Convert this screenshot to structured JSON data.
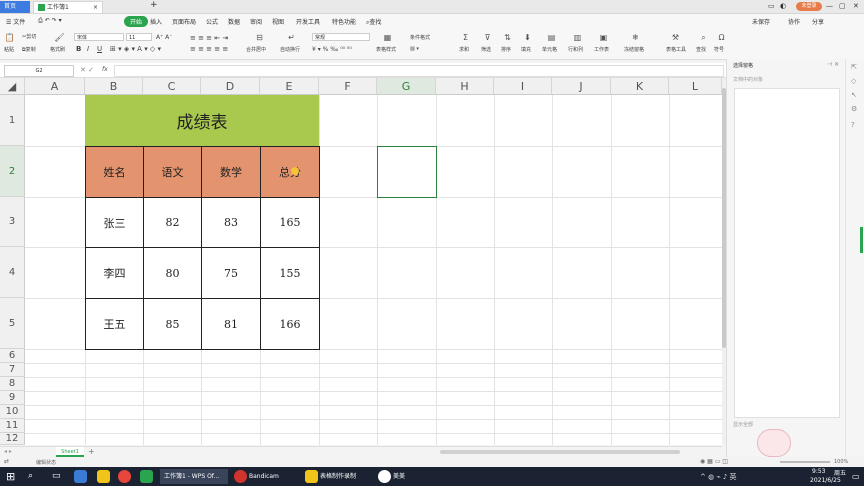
{
  "app": {
    "home_tab": "首页",
    "book_tab": "工作簿1",
    "tab_close": "×",
    "new_tab": "+",
    "login_button": "未登录"
  },
  "menu": {
    "file": "☰ 文件",
    "start": "开始",
    "items": [
      "插入",
      "页面布局",
      "公式",
      "数据",
      "审阅",
      "视图",
      "开发工具",
      "特色功能"
    ],
    "search": "查找",
    "right_items": [
      "未保存",
      "协作",
      "分享"
    ]
  },
  "toolbar": {
    "cut": "剪切",
    "paste": "粘贴",
    "copy": "复制",
    "format_painter": "格式刷",
    "font_name": "宋体",
    "font_size": "11",
    "bold": "B",
    "italic": "I",
    "underline": "U",
    "merge": "合并居中",
    "wrap": "自动换行",
    "number_format": "常规",
    "table_style": "表格样式",
    "cond_format": "条件格式",
    "sum": "求和",
    "filter": "筛选",
    "sort": "排序",
    "fill": "填充",
    "cell": "单元格",
    "rowcol": "行和列",
    "worksheet": "工作表",
    "freeze": "冻结窗格",
    "table_tools": "表格工具",
    "find": "查找",
    "symbol": "符号"
  },
  "formula_bar": {
    "name_box": "G2",
    "fx": "fx",
    "content": ""
  },
  "sheet": {
    "columns": [
      "A",
      "B",
      "C",
      "D",
      "E",
      "F",
      "G",
      "H",
      "I",
      "J",
      "K",
      "L"
    ],
    "rows": [
      "1",
      "2",
      "3",
      "4",
      "5",
      "6",
      "7",
      "8",
      "9",
      "10",
      "11",
      "12"
    ],
    "title": "成绩表",
    "headers": [
      "姓名",
      "语文",
      "数学",
      "总分"
    ],
    "records": [
      [
        "张三",
        "82",
        "83",
        "165"
      ],
      [
        "李四",
        "80",
        "75",
        "155"
      ],
      [
        "王五",
        "85",
        "81",
        "166"
      ]
    ],
    "sheet_tab": "Sheet1",
    "add_sheet": "+"
  },
  "right_panel": {
    "title": "选择窗格",
    "subtitle": "文档中的对象",
    "footer": "显示全部"
  },
  "status": {
    "left": "编辑状态",
    "zoom": "100%"
  },
  "taskbar": {
    "items": [
      "工作簿1 - WPS Of...",
      "Bandicam",
      "表格制作录制",
      "美美"
    ],
    "time": "9:53",
    "day": "周五",
    "date": "2021/6/25"
  },
  "colors": {
    "title_fill": "#a9c94e",
    "header_fill": "#e3946e",
    "accent": "#2aa44f"
  }
}
